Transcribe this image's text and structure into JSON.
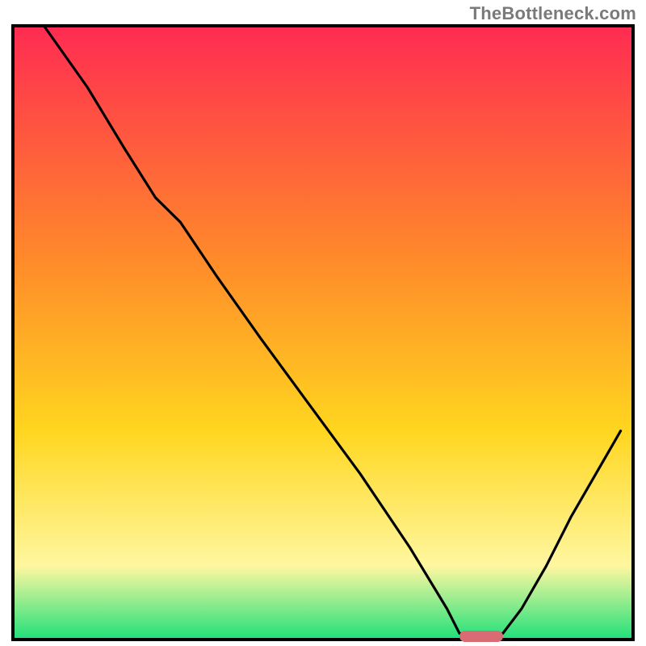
{
  "watermark": "TheBottleneck.com",
  "colors": {
    "gradient_top": "#ff2b52",
    "gradient_mid1": "#ff8a2a",
    "gradient_mid2": "#ffd61f",
    "gradient_mid3": "#fff7a0",
    "gradient_bottom": "#1fe07a",
    "curve": "#000000",
    "marker": "#d96b74",
    "frame": "#000000"
  },
  "chart_data": {
    "type": "line",
    "title": "",
    "xlabel": "",
    "ylabel": "",
    "xlim": [
      0,
      100
    ],
    "ylim": [
      0,
      100
    ],
    "notes": "Single black curve over a vertical rainbow gradient background (red at top through orange, yellow, pale yellow, to green at the very bottom). Curve starts at top-left, descends with a kink around x≈25, reaches a flat minimum near x≈72–79 along the bottom edge, then rises to the right. A small rounded red marker sits at the minimum on the bottom edge.",
    "series": [
      {
        "name": "curve",
        "x": [
          5,
          12,
          18,
          23,
          27,
          33,
          40,
          48,
          56,
          64,
          70,
          72,
          76,
          79,
          82,
          86,
          90,
          94,
          98
        ],
        "values": [
          100,
          90,
          80,
          72,
          68,
          59,
          49,
          38,
          27,
          15,
          5,
          1,
          0.5,
          1,
          5,
          12,
          20,
          27,
          34
        ]
      }
    ],
    "marker": {
      "x_start": 72,
      "x_end": 79,
      "y": 0.5,
      "color": "#d96b74"
    },
    "frame": {
      "x0": 2,
      "y0": 4,
      "x1": 98,
      "y1": 99
    }
  }
}
